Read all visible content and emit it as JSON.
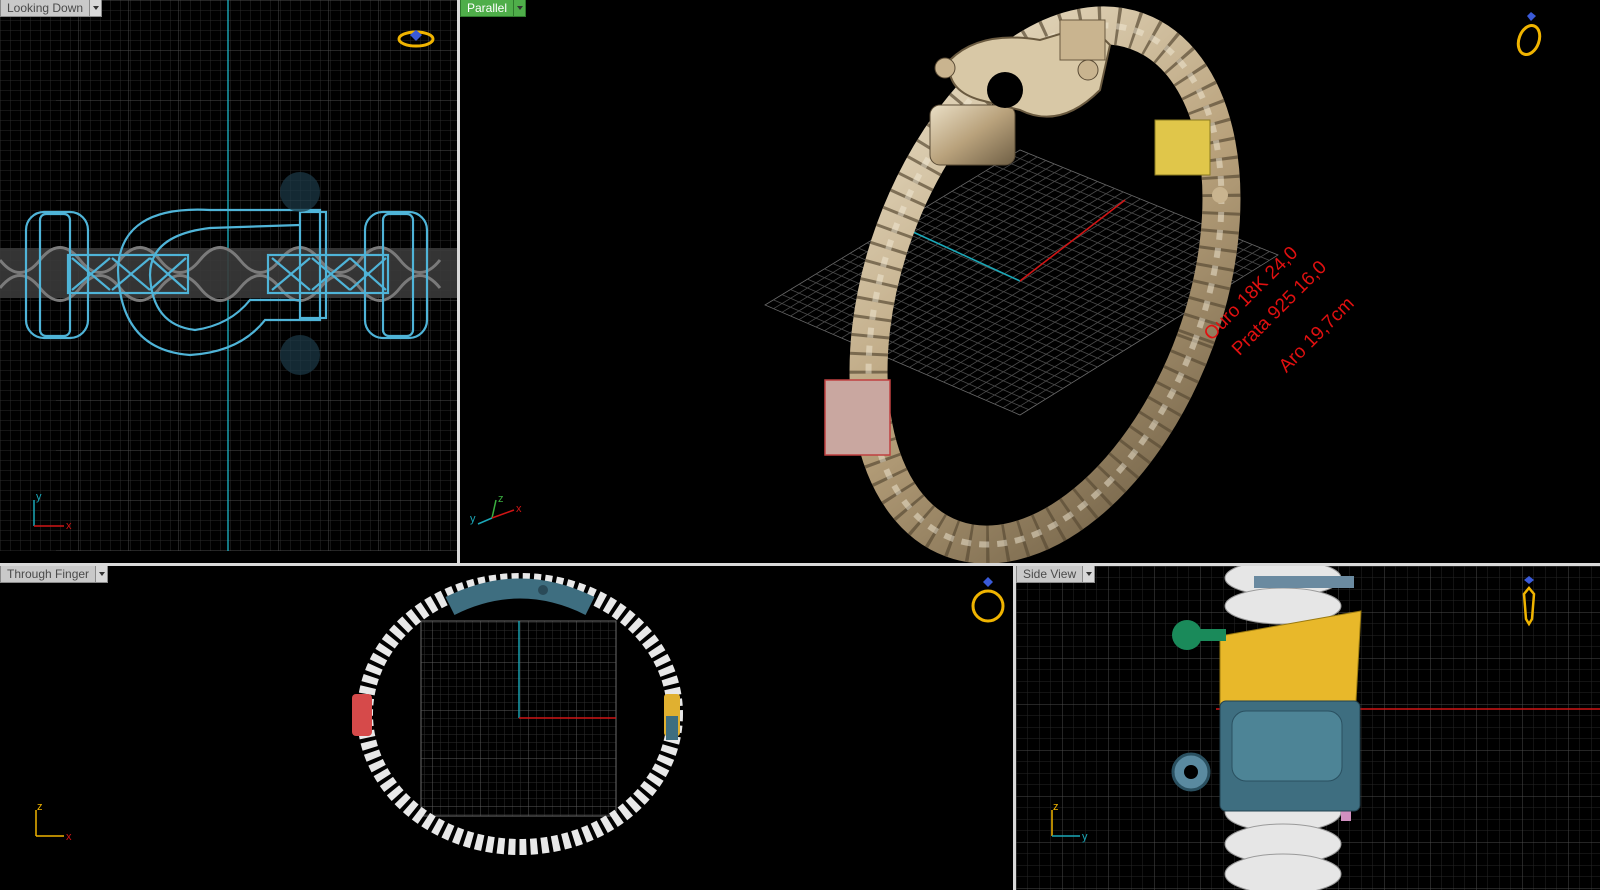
{
  "viewports": {
    "top_left": {
      "label": "Looking Down"
    },
    "top_right": {
      "label": "Parallel"
    },
    "bottom_left": {
      "label": "Through Finger"
    },
    "bottom_right": {
      "label": "Side View"
    }
  },
  "axes": {
    "top_left": {
      "a": "y",
      "b": "x"
    },
    "top_right": {
      "a": "z",
      "b": "y",
      "c": "x"
    },
    "bottom_left": {
      "a": "z",
      "b": "x"
    },
    "bottom_right": {
      "a": "z",
      "b": "y"
    }
  },
  "annotations": {
    "line1": "Ouro 18K 24,0",
    "line2": "Prata 925 16,0",
    "line3": "Aro 19,7cm"
  },
  "colors": {
    "grid": "#3a3a3a",
    "x_axis": "#d01515",
    "y_axis": "#1ba8b8",
    "gold_metal": "#c9b48f",
    "annotation": "#e01010",
    "active_tab": "#4fae4a"
  },
  "icons": [
    "ring-view-icon"
  ]
}
